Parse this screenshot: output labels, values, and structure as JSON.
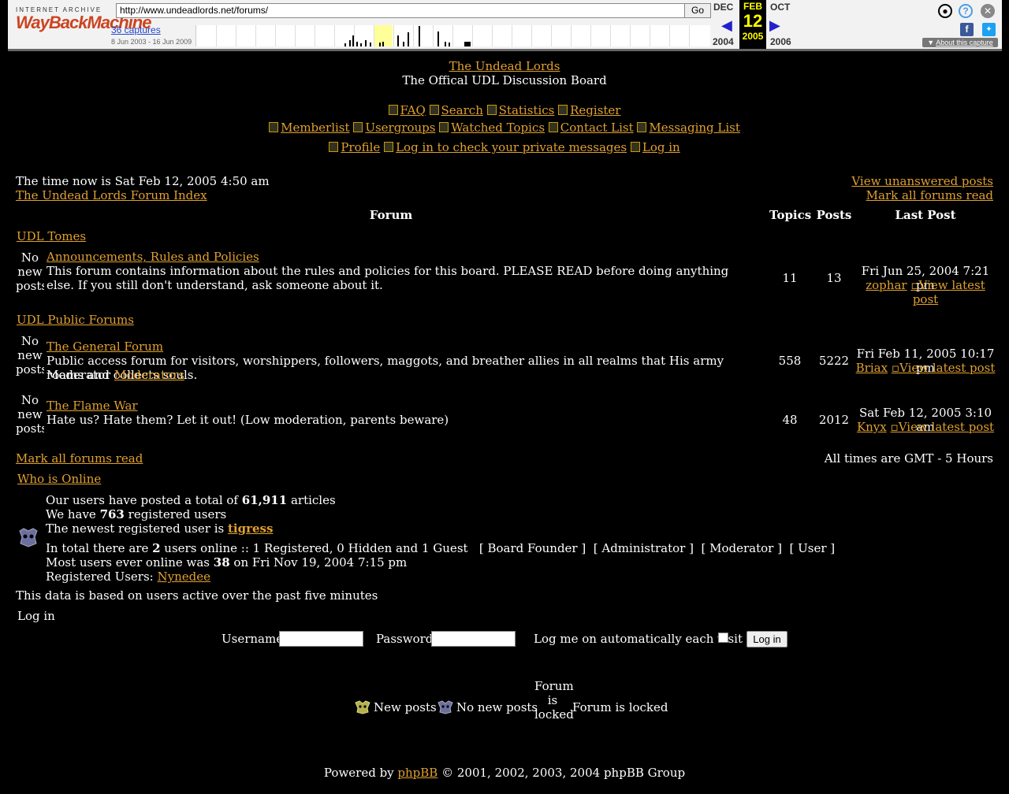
{
  "wayback": {
    "logo_top": "INTERNET ARCHIVE",
    "logo_main": "WayBackMachine",
    "url": "http://www.undeadlords.net/forums/",
    "go_label": "Go",
    "captures": "36 captures",
    "range": "8 Jun 2003 - 16 Jun 2009",
    "prev_month": "DEC",
    "cur_month": "FEB",
    "next_month": "OCT",
    "cur_day": "12",
    "prev_year": "2004",
    "cur_year": "2005",
    "next_year": "2006",
    "about": "About this capture"
  },
  "site": {
    "title": "The Undead Lords",
    "subtitle": "The Offical UDL Discussion Board"
  },
  "nav": {
    "row1": [
      "FAQ",
      "Search",
      "Statistics",
      "Register"
    ],
    "row2": [
      "Memberlist",
      "Usergroups",
      "Watched Topics",
      "Contact List",
      "Messaging List"
    ],
    "row3": [
      "Profile",
      "Log in to check your private messages",
      "Log in"
    ]
  },
  "index": {
    "time_now": "The time now is Sat Feb 12, 2005 4:50 am",
    "breadcrumb": "The Undead Lords Forum Index",
    "view_unanswered": "View unanswered posts",
    "mark_read_top": "Mark all forums read",
    "col_forum": "Forum",
    "col_topics": "Topics",
    "col_posts": "Posts",
    "col_last": "Last Post",
    "no_new_alt": "No new posts",
    "view_latest_alt": "View latest post"
  },
  "categories": [
    {
      "name": "UDL Tomes",
      "forums": [
        {
          "name": "Announcements, Rules and Policies",
          "desc": "This forum contains information about the rules and policies for this board. PLEASE READ before doing anything else. If you still don't understand, ask someone about it.",
          "topics": "11",
          "posts": "13",
          "last_date": "Fri Jun 25, 2004 7:21 pm",
          "last_user": "zophar"
        }
      ]
    },
    {
      "name": "UDL Public Forums",
      "forums": [
        {
          "name": "The General Forum",
          "desc": "Public access forum for visitors, worshippers, followers, maggots, and breather allies in all realms that His army roams and collects souls.",
          "moderator_label": "Moderator",
          "moderator": "Moderators",
          "topics": "558",
          "posts": "5222",
          "last_date": "Fri Feb 11, 2005 10:17 pm",
          "last_user": "Briax"
        },
        {
          "name": "The Flame War",
          "desc": "Hate us? Hate them? Let it out! (Low moderation, parents beware)",
          "topics": "48",
          "posts": "2012",
          "last_date": "Sat Feb 12, 2005 3:10 am",
          "last_user": "Knyx"
        }
      ]
    }
  ],
  "footer_row": {
    "mark_read": "Mark all forums read",
    "timezone": "All times are GMT - 5 Hours"
  },
  "online": {
    "header": "Who is Online",
    "line1_pre": "Our users have posted a total of ",
    "line1_num": "61,911",
    "line1_post": " articles",
    "line2_pre": "We have ",
    "line2_num": "763",
    "line2_post": " registered users",
    "line3_pre": "The newest registered user is ",
    "line3_user": "tigress",
    "line4_pre": "In total there are ",
    "line4_num": "2",
    "line4_post": " users online :: 1 Registered, 0 Hidden and 1 Guest   [ Board Founder ]  [ Administrator ]  [ Moderator ]  [ User ]",
    "line5_pre": "Most users ever online was ",
    "line5_num": "38",
    "line5_post": " on Fri Nov 19, 2004 7:15 pm",
    "line6_pre": "Registered Users: ",
    "line6_user": "Nynedee",
    "note": "This data is based on users active over the past five minutes"
  },
  "login": {
    "header": "Log in",
    "username_label": "Username:",
    "password_label": "Password:",
    "auto_label": "Log me on automatically each visit",
    "button": "Log in"
  },
  "legend": {
    "new_posts": "New posts",
    "no_new_posts": "No new posts",
    "locked_alt": "Forum is locked",
    "locked": "Forum is locked"
  },
  "powered": {
    "pre": "Powered by ",
    "link": "phpBB",
    "post": " © 2001, 2002, 2003, 2004 phpBB Group"
  }
}
